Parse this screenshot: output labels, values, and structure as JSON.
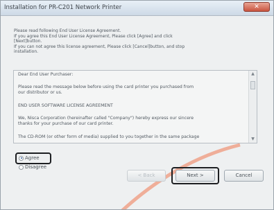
{
  "window": {
    "title": "Installation for PR-C201 Network Printer",
    "close_label": "✕"
  },
  "instructions": [
    "Please read following End User License Agreement.",
    "If you agree this End User License Agreement, Please click [Agree] and click",
    "[Next]button.",
    "If you can not agree this license agreement, Please click [Cancel]button, and stop",
    "installation."
  ],
  "license": {
    "lines": [
      "Dear End User Purchaser:",
      "Please read the message below before using the card printer you purchased from",
      "our distributor or us.",
      "END USER SOFTWARE LICENSE AGREEMENT",
      "We, Nisca Corporation (hereinafter called \"Company\") hereby express our sincere",
      "thanks for your purchase of our card printer.",
      "The CD-ROM (or other form of media) supplied to you together in the same package"
    ],
    "scroll_up": "▲",
    "scroll_down": "▼"
  },
  "agreement": {
    "agree_label": "Agree",
    "disagree_label": "Disagree",
    "selected": "Agree"
  },
  "buttons": {
    "back_label": "< Back",
    "next_label": "Next >",
    "cancel_label": "Cancel"
  },
  "colors": {
    "swoosh": "#f08a6a",
    "highlight": "#1d1f22",
    "radio_dot": "#2f5e9e"
  }
}
